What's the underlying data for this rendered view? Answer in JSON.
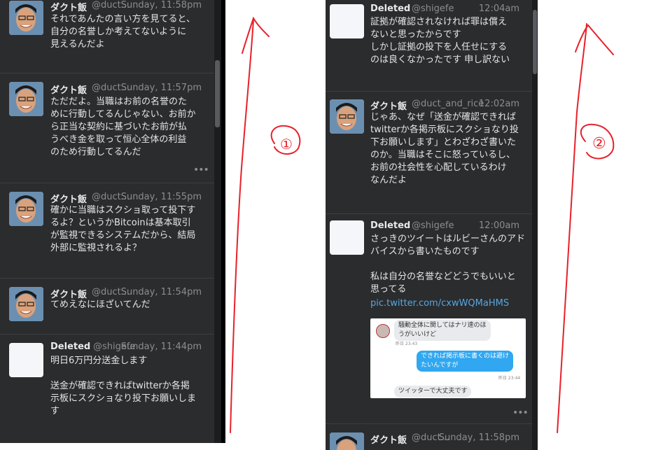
{
  "left_column": {
    "tweets": [
      {
        "name": "ダクト飯",
        "handle": "@duct...",
        "time": "Sunday, 11:58pm",
        "lines": [
          "それであんたの言い方を見てると、",
          "自分の名誉しか考えてないように",
          "見えるんだよ"
        ]
      },
      {
        "name": "ダクト飯",
        "handle": "@duct...",
        "time": "Sunday, 11:57pm",
        "lines": [
          "ただだよ。当職はお前の名誉のた",
          "めに行動してるんじゃない、お前か",
          "ら正当な契約に基づいたお前が払",
          "うべき金を取って恒心全体の利益",
          "のため行動してるんだ"
        ],
        "more": "•••"
      },
      {
        "name": "ダクト飯",
        "handle": "@duct...",
        "time": "Sunday, 11:55pm",
        "lines": [
          "確かに当職はスクショ取って投下す",
          "るよ？というかBitcoinは基本取引",
          "が監視できるシステムだから、結局",
          "外部に監視されるよ？"
        ]
      },
      {
        "name": "ダクト飯",
        "handle": "@duct...",
        "time": "Sunday, 11:54pm",
        "lines": [
          "てめえなにほざいてんだ"
        ]
      },
      {
        "name": "Deleted",
        "handle": "@shigefe",
        "time": "Sunday, 11:44pm",
        "lines": [
          "明日6万円分送金します",
          "",
          "送金が確認できればtwitterか各掲",
          "示板にスクショなり投下お願いしま",
          "す"
        ]
      }
    ]
  },
  "right_column": {
    "tweets": [
      {
        "name": "Deleted",
        "handle": "@shigefe",
        "time": "12:04am",
        "lines": [
          "証拠が確認されなければ罪は償え",
          "ないと思ったからです",
          "しかし証拠の投下を人任せにする",
          "のは良くなかったです 申し訳ない"
        ]
      },
      {
        "name": "ダクト飯",
        "handle": "@duct_and_rice",
        "time": "12:02am",
        "lines": [
          "じゃあ、なぜ「送金が確認できれば",
          "twitterか各掲示板にスクショなり投",
          "下お願いします」とわざわざ書いた",
          "のか。当職はそこに怒っているし、",
          "お前の社会性を心配しているわけ",
          "なんだよ"
        ]
      },
      {
        "name": "Deleted",
        "handle": "@shigefe",
        "time": "12:00am",
        "lines": [
          "さっきのツイートはルビーさんのアド",
          "バイスから書いたものです",
          "",
          "私は自分の名誉などどうでもいいと",
          "思ってる"
        ],
        "link": "pic.twitter.com/cxwWQMaHMS",
        "more": "•••",
        "embed": {
          "msg1": "騒動全体に関してはナリ速のほ",
          "msg1b": "うがいいけど",
          "ts1": "昨日 23:43",
          "msg2": "できれば掲示板に書くのは避け",
          "msg2b": "たいんですが",
          "ts2": "昨日 23:44",
          "msg3": "ツイッターで大丈夫です"
        }
      },
      {
        "name": "ダクト飯",
        "handle": "@duct...",
        "time": "Sunday, 11:58pm",
        "lines": []
      }
    ]
  },
  "annotations": {
    "label_1": "①",
    "label_2": "②"
  },
  "colors": {
    "background": "#2b2c2e",
    "text": "#e6e6e6",
    "muted": "#8b8d91",
    "link": "#56a7e0",
    "annotation": "#e8202a"
  }
}
